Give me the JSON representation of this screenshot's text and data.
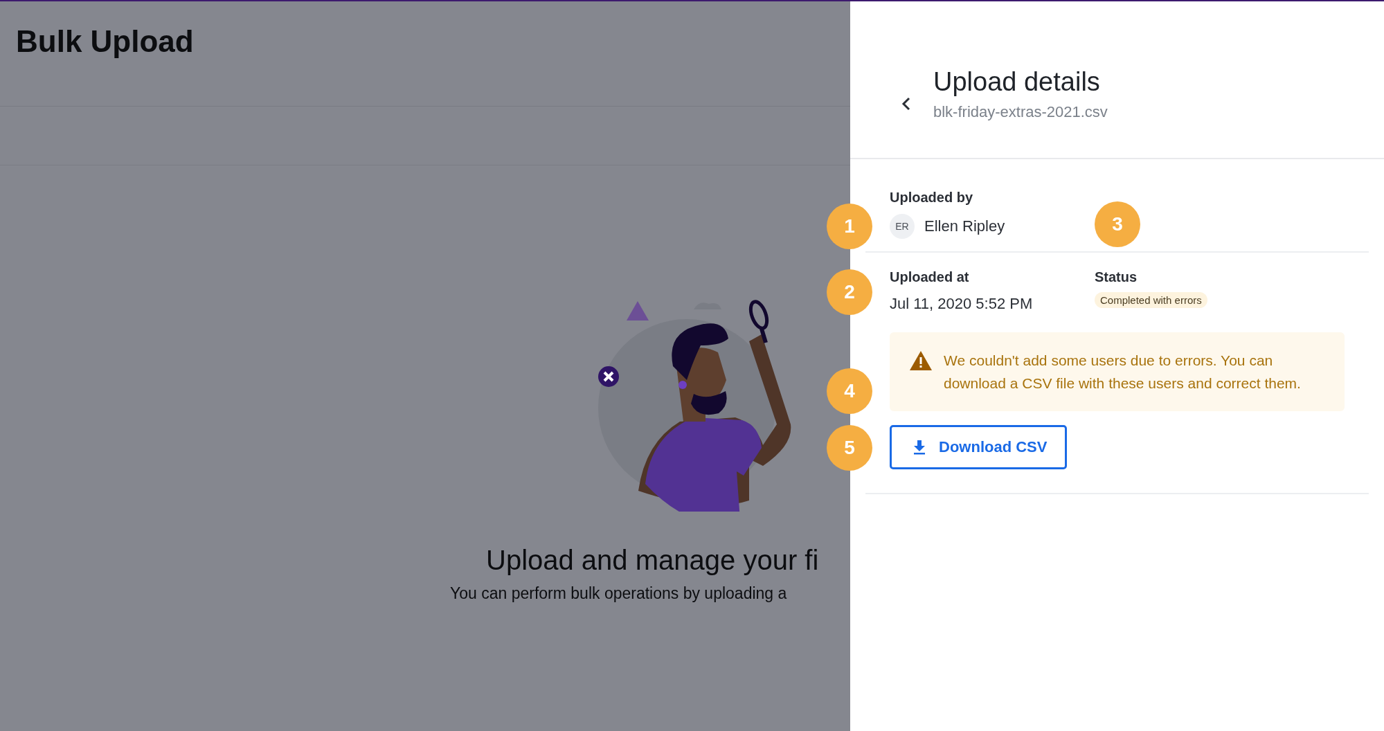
{
  "page": {
    "title": "Bulk Upload",
    "empty_state": {
      "heading": "Upload and manage your fi",
      "text": "You can perform bulk operations by uploading a"
    }
  },
  "panel": {
    "title": "Upload details",
    "filename": "blk-friday-extras-2021.csv",
    "uploaded_by": {
      "label": "Uploaded by",
      "initials": "ER",
      "name": "Ellen Ripley",
      "marker": "1"
    },
    "uploaded_at": {
      "label": "Uploaded at",
      "value": "Jul 11, 2020 5:52 PM",
      "marker": "2"
    },
    "status": {
      "label": "Status",
      "value": "Completed with errors",
      "marker": "3"
    },
    "alert": {
      "text": "We couldn't add some users due to errors. You can download a CSV file with these users and correct them.",
      "marker": "4"
    },
    "button": {
      "label": "Download CSV",
      "marker": "5"
    }
  }
}
